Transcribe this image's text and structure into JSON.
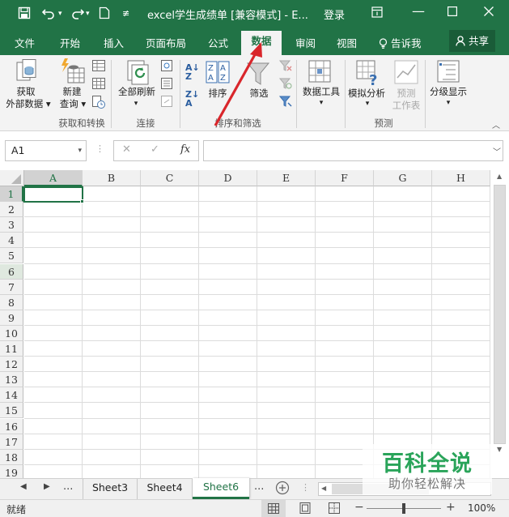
{
  "titlebar": {
    "title": "excel学生成绩单  [兼容模式] - E...",
    "login": "登录"
  },
  "tabs": [
    "文件",
    "开始",
    "插入",
    "页面布局",
    "公式",
    "数据",
    "审阅",
    "视图"
  ],
  "tell_me": "告诉我",
  "share": "共享",
  "ribbon": {
    "get_data_1": "获取",
    "get_data_2": "外部数据",
    "new_query_1": "新建",
    "new_query_2": "查询",
    "group_get_transform": "获取和转换",
    "refresh_all": "全部刷新",
    "group_connections": "连接",
    "sort": "排序",
    "filter": "筛选",
    "group_sort_filter": "排序和筛选",
    "data_tools": "数据工具",
    "what_if": "模拟分析",
    "forecast_1": "预测",
    "forecast_2": "工作表",
    "group_forecast": "预测",
    "outline": "分级显示"
  },
  "formula_bar": {
    "name_box": "A1",
    "fx": "fx",
    "value": ""
  },
  "columns": [
    "A",
    "B",
    "C",
    "D",
    "E",
    "F",
    "G",
    "H"
  ],
  "rows": [
    "1",
    "2",
    "3",
    "4",
    "5",
    "6",
    "7",
    "8",
    "9",
    "10",
    "11",
    "12",
    "13",
    "14",
    "15",
    "16",
    "17",
    "18",
    "19"
  ],
  "sheets": [
    "Sheet3",
    "Sheet4",
    "Sheet6"
  ],
  "active_sheet": "Sheet6",
  "ellipsis": "...",
  "status": {
    "ready": "就绪",
    "zoom": "100%"
  },
  "watermark": {
    "line1": "百科全说",
    "line2": "助你轻松解决"
  },
  "colors": {
    "excel_green": "#217346",
    "arrow_red": "#d9262b"
  }
}
